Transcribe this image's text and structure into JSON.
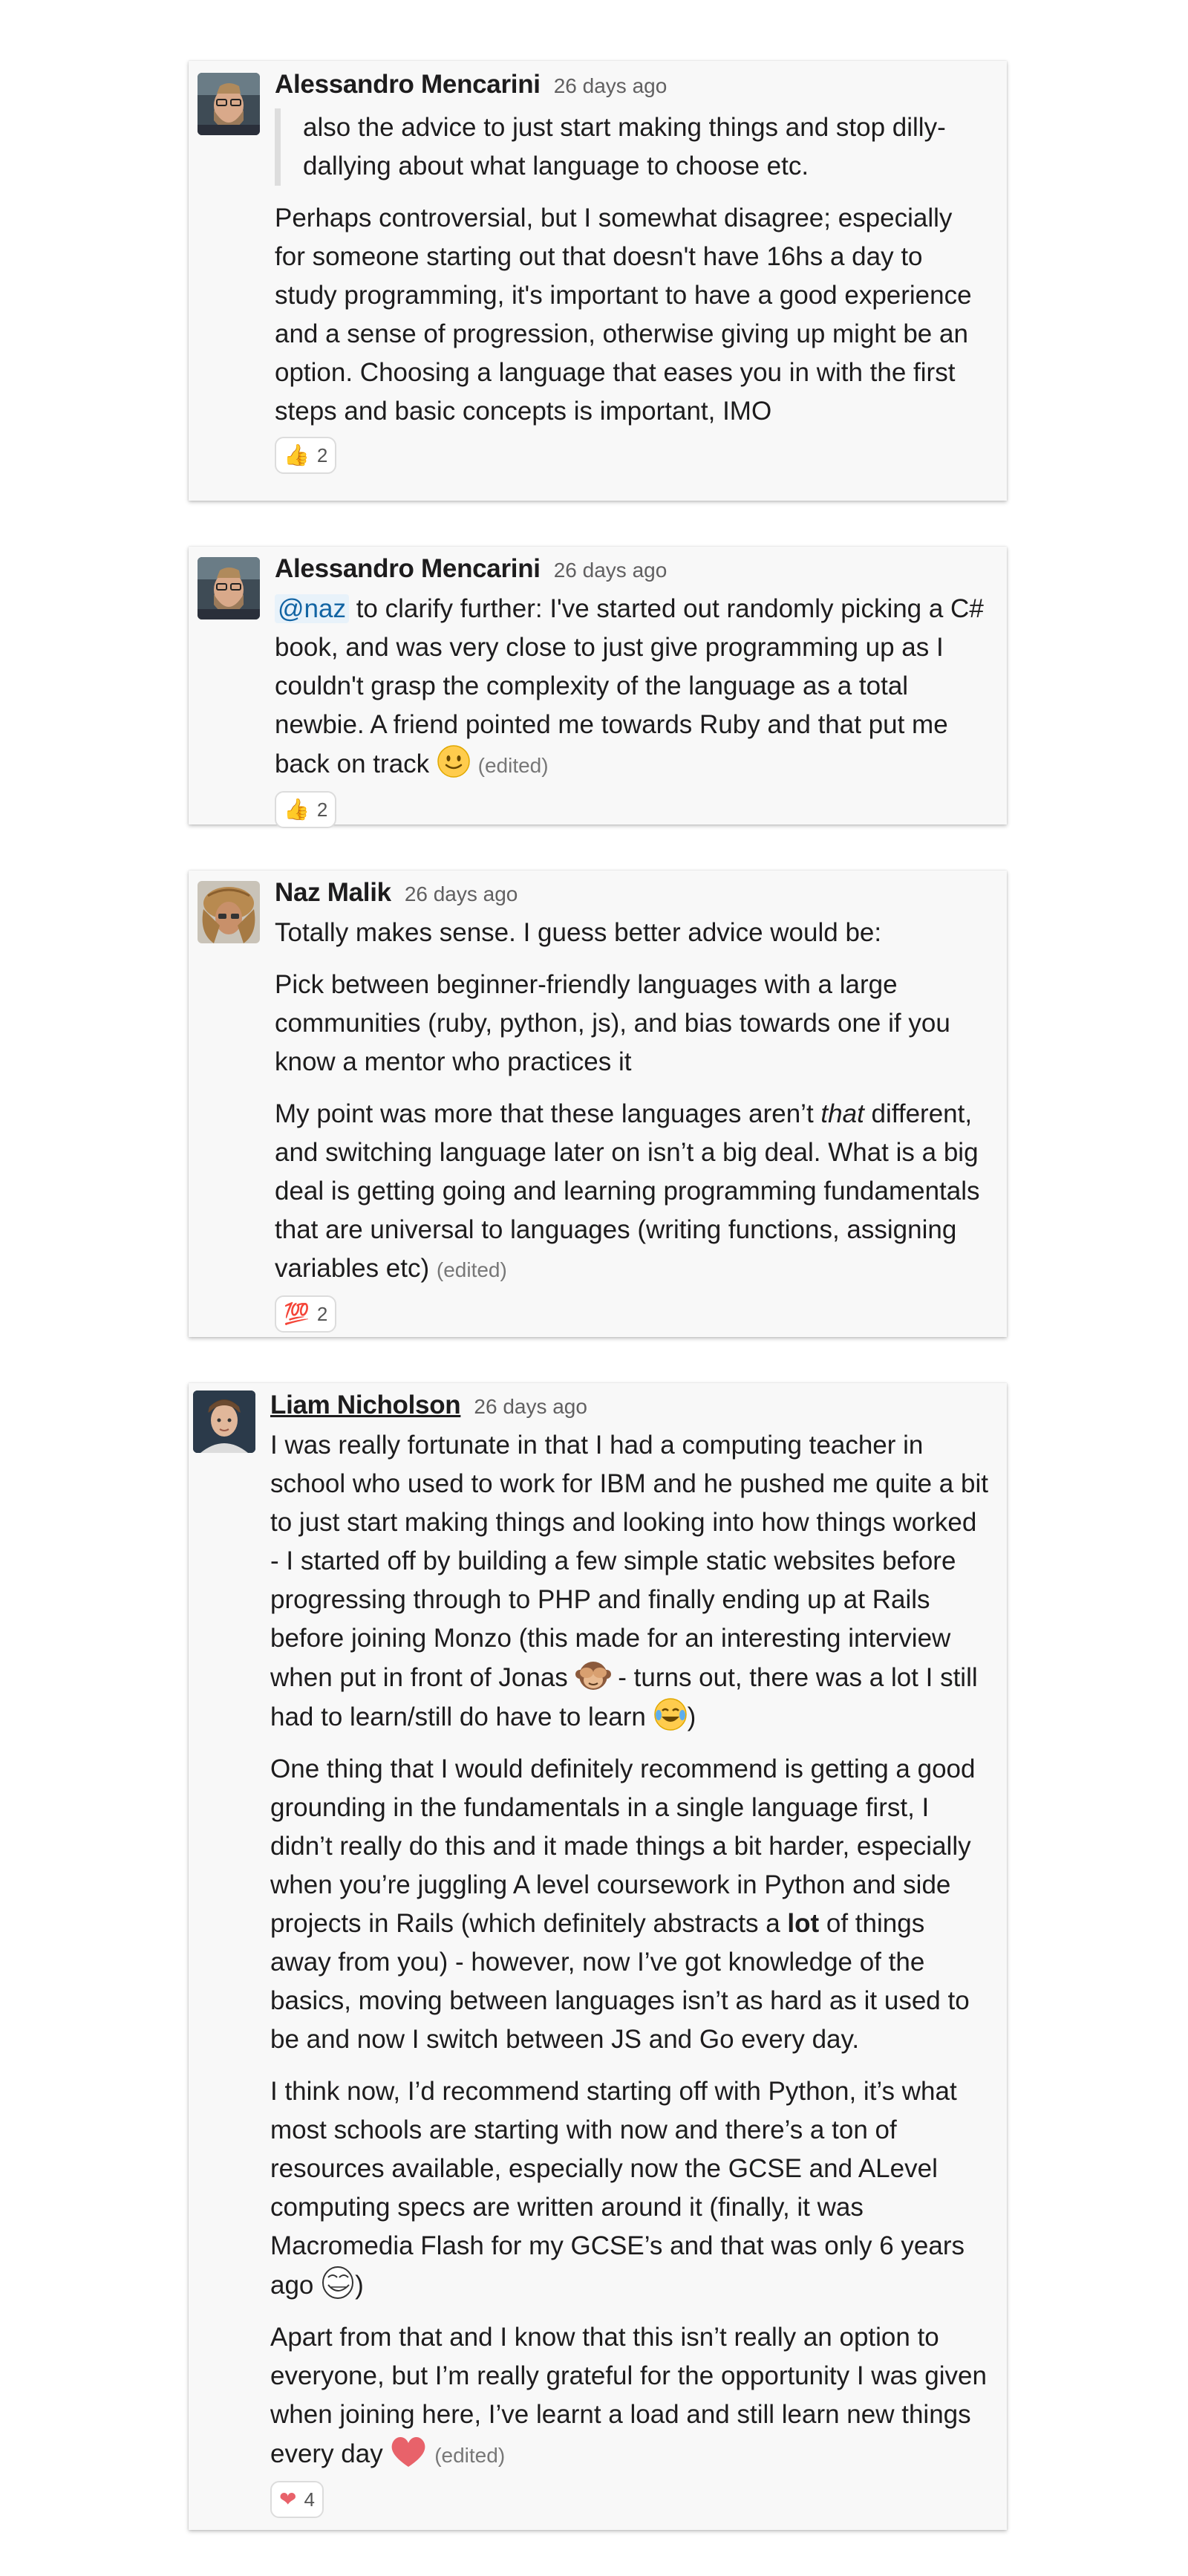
{
  "messages": [
    {
      "author": "Alessandro Mencarini",
      "time": "26 days ago",
      "quote": "also the advice to just start making things and stop dilly-dallying about what language to choose etc.",
      "p1": "Perhaps controversial, but I somewhat disagree; especially for someone starting out that doesn't have 16hs a day to study programming, it's important to have a good experience and a sense of progression, otherwise giving up might be an option. Choosing a language that eases you in with the first steps and basic concepts is important, IMO",
      "reaction": {
        "emoji": "👍",
        "icon": "thumbs-up-icon",
        "count": "2"
      }
    },
    {
      "author": "Alessandro Mencarini",
      "time": "26 days ago",
      "mention": "@naz",
      "p1": " to clarify further: I've started out randomly picking a C# book, and was very close to just give programming up as I couldn't grasp the complexity of the language as a total newbie. A friend pointed me towards Ruby and that put me back on track ",
      "emoji_icon": "slightly-smiling-face-icon",
      "edited": "(edited)",
      "reaction": {
        "emoji": "👍",
        "icon": "thumbs-up-icon",
        "count": "2"
      }
    },
    {
      "author": "Naz Malik",
      "time": "26 days ago",
      "p1": "Totally makes sense. I guess better advice would be:",
      "p2": "Pick between beginner-friendly languages with a large communities (ruby, python, js), and bias towards one if you know a mentor who practices it",
      "p3a": "My point was more that these languages aren’t ",
      "p3em": "that",
      "p3b": " different, and switching language later on isn’t a big deal. What is a big deal is getting going and learning programming fundamentals that are universal to languages (writing functions, assigning variables etc) ",
      "edited": "(edited)",
      "reaction": {
        "emoji": "💯",
        "icon": "hundred-points-icon",
        "count": "2"
      }
    },
    {
      "author": "Liam Nicholson",
      "time": "26 days ago",
      "p1a": "I was really fortunate in that I had a computing teacher in school who used to work for IBM and he pushed me quite a bit to just start making things and looking into how things worked - I started off by building a few simple static websites before progressing through to PHP and finally ending up at Rails before joining Monzo (this made for an interesting interview when put in front of Jonas ",
      "p1b": " - turns out, there was a lot I still had to learn/still do have to learn ",
      "p1c": ")",
      "p2a": "One thing that I would definitely recommend is getting a good grounding in the fundamentals in a single language first, I didn’t really do this and it made things a bit harder, especially when you’re juggling A level coursework in Python and side projects in Rails (which definitely abstracts a ",
      "p2b": "lot",
      "p2c": " of things away from you) - however, now I’ve got knowledge of the basics, moving between languages isn’t as hard as it used to be and now I switch between JS and Go every day.",
      "p3a": "I think now, I’d recommend starting off with Python, it’s what most schools are starting with now and there’s a ton of resources available, especially now the GCSE and ALevel computing specs are written around it (finally, it was Macromedia Flash for my GCSE’s and that was only 6 years ago ",
      "p3b": ")",
      "p4": "Apart from that and I know that this isn’t really an option to everyone, but I’m really grateful for the opportunity I was given when joining here, I’ve learnt a load and still learn new things every day ",
      "edited": "(edited)",
      "reaction": {
        "emoji": "❤",
        "icon": "heart-icon",
        "count": "4"
      },
      "emoji_icons": [
        "see-no-evil-monkey-icon",
        "joy-face-icon",
        "troll-face-icon",
        "heart-icon"
      ]
    }
  ],
  "colors": {
    "card_bg": "#f8f8f8",
    "mention": "#1264a3",
    "timestamp": "#616061",
    "heart": "#e8626a"
  }
}
